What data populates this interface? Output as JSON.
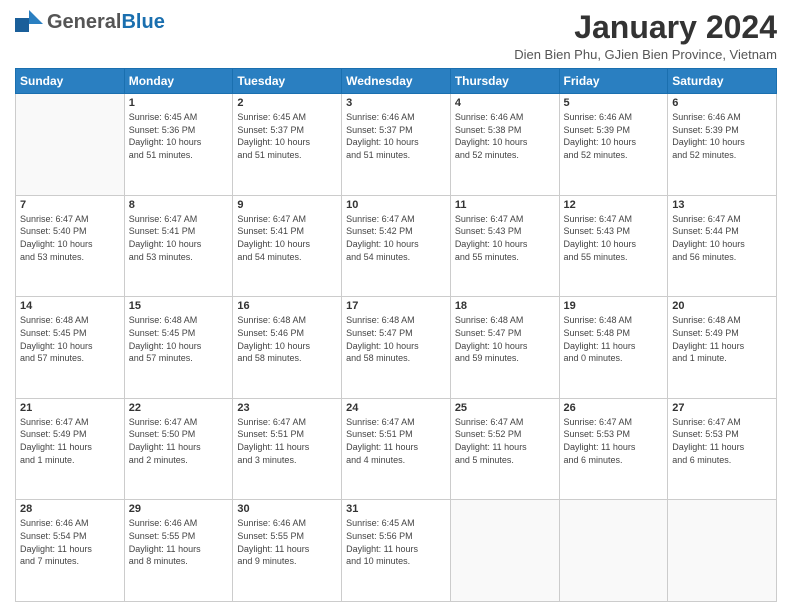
{
  "header": {
    "logo_general": "General",
    "logo_blue": "Blue",
    "month_title": "January 2024",
    "location": "Dien Bien Phu, GJien Bien Province, Vietnam"
  },
  "days_of_week": [
    "Sunday",
    "Monday",
    "Tuesday",
    "Wednesday",
    "Thursday",
    "Friday",
    "Saturday"
  ],
  "weeks": [
    [
      {
        "day": "",
        "info": ""
      },
      {
        "day": "1",
        "info": "Sunrise: 6:45 AM\nSunset: 5:36 PM\nDaylight: 10 hours\nand 51 minutes."
      },
      {
        "day": "2",
        "info": "Sunrise: 6:45 AM\nSunset: 5:37 PM\nDaylight: 10 hours\nand 51 minutes."
      },
      {
        "day": "3",
        "info": "Sunrise: 6:46 AM\nSunset: 5:37 PM\nDaylight: 10 hours\nand 51 minutes."
      },
      {
        "day": "4",
        "info": "Sunrise: 6:46 AM\nSunset: 5:38 PM\nDaylight: 10 hours\nand 52 minutes."
      },
      {
        "day": "5",
        "info": "Sunrise: 6:46 AM\nSunset: 5:39 PM\nDaylight: 10 hours\nand 52 minutes."
      },
      {
        "day": "6",
        "info": "Sunrise: 6:46 AM\nSunset: 5:39 PM\nDaylight: 10 hours\nand 52 minutes."
      }
    ],
    [
      {
        "day": "7",
        "info": "Sunrise: 6:47 AM\nSunset: 5:40 PM\nDaylight: 10 hours\nand 53 minutes."
      },
      {
        "day": "8",
        "info": "Sunrise: 6:47 AM\nSunset: 5:41 PM\nDaylight: 10 hours\nand 53 minutes."
      },
      {
        "day": "9",
        "info": "Sunrise: 6:47 AM\nSunset: 5:41 PM\nDaylight: 10 hours\nand 54 minutes."
      },
      {
        "day": "10",
        "info": "Sunrise: 6:47 AM\nSunset: 5:42 PM\nDaylight: 10 hours\nand 54 minutes."
      },
      {
        "day": "11",
        "info": "Sunrise: 6:47 AM\nSunset: 5:43 PM\nDaylight: 10 hours\nand 55 minutes."
      },
      {
        "day": "12",
        "info": "Sunrise: 6:47 AM\nSunset: 5:43 PM\nDaylight: 10 hours\nand 55 minutes."
      },
      {
        "day": "13",
        "info": "Sunrise: 6:47 AM\nSunset: 5:44 PM\nDaylight: 10 hours\nand 56 minutes."
      }
    ],
    [
      {
        "day": "14",
        "info": "Sunrise: 6:48 AM\nSunset: 5:45 PM\nDaylight: 10 hours\nand 57 minutes."
      },
      {
        "day": "15",
        "info": "Sunrise: 6:48 AM\nSunset: 5:45 PM\nDaylight: 10 hours\nand 57 minutes."
      },
      {
        "day": "16",
        "info": "Sunrise: 6:48 AM\nSunset: 5:46 PM\nDaylight: 10 hours\nand 58 minutes."
      },
      {
        "day": "17",
        "info": "Sunrise: 6:48 AM\nSunset: 5:47 PM\nDaylight: 10 hours\nand 58 minutes."
      },
      {
        "day": "18",
        "info": "Sunrise: 6:48 AM\nSunset: 5:47 PM\nDaylight: 10 hours\nand 59 minutes."
      },
      {
        "day": "19",
        "info": "Sunrise: 6:48 AM\nSunset: 5:48 PM\nDaylight: 11 hours\nand 0 minutes."
      },
      {
        "day": "20",
        "info": "Sunrise: 6:48 AM\nSunset: 5:49 PM\nDaylight: 11 hours\nand 1 minute."
      }
    ],
    [
      {
        "day": "21",
        "info": "Sunrise: 6:47 AM\nSunset: 5:49 PM\nDaylight: 11 hours\nand 1 minute."
      },
      {
        "day": "22",
        "info": "Sunrise: 6:47 AM\nSunset: 5:50 PM\nDaylight: 11 hours\nand 2 minutes."
      },
      {
        "day": "23",
        "info": "Sunrise: 6:47 AM\nSunset: 5:51 PM\nDaylight: 11 hours\nand 3 minutes."
      },
      {
        "day": "24",
        "info": "Sunrise: 6:47 AM\nSunset: 5:51 PM\nDaylight: 11 hours\nand 4 minutes."
      },
      {
        "day": "25",
        "info": "Sunrise: 6:47 AM\nSunset: 5:52 PM\nDaylight: 11 hours\nand 5 minutes."
      },
      {
        "day": "26",
        "info": "Sunrise: 6:47 AM\nSunset: 5:53 PM\nDaylight: 11 hours\nand 6 minutes."
      },
      {
        "day": "27",
        "info": "Sunrise: 6:47 AM\nSunset: 5:53 PM\nDaylight: 11 hours\nand 6 minutes."
      }
    ],
    [
      {
        "day": "28",
        "info": "Sunrise: 6:46 AM\nSunset: 5:54 PM\nDaylight: 11 hours\nand 7 minutes."
      },
      {
        "day": "29",
        "info": "Sunrise: 6:46 AM\nSunset: 5:55 PM\nDaylight: 11 hours\nand 8 minutes."
      },
      {
        "day": "30",
        "info": "Sunrise: 6:46 AM\nSunset: 5:55 PM\nDaylight: 11 hours\nand 9 minutes."
      },
      {
        "day": "31",
        "info": "Sunrise: 6:45 AM\nSunset: 5:56 PM\nDaylight: 11 hours\nand 10 minutes."
      },
      {
        "day": "",
        "info": ""
      },
      {
        "day": "",
        "info": ""
      },
      {
        "day": "",
        "info": ""
      }
    ]
  ]
}
